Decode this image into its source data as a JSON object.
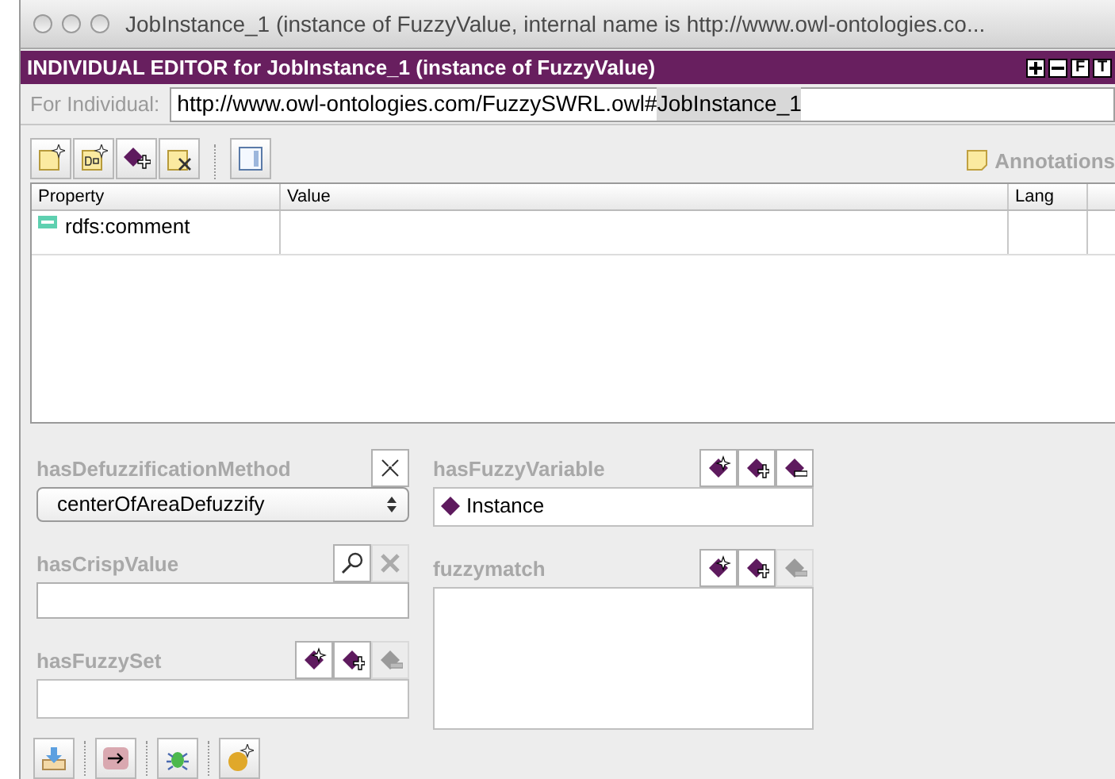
{
  "window": {
    "title": "JobInstance_1   (instance of FuzzyValue, internal name is http://www.owl-ontologies.co..."
  },
  "editor_header": {
    "title": "INDIVIDUAL EDITOR for JobInstance_1   (instance of FuzzyValue)",
    "buttons": [
      {
        "kind": "plus"
      },
      {
        "kind": "minus"
      },
      {
        "kind": "letter",
        "label": "F"
      },
      {
        "kind": "letter",
        "label": "T"
      }
    ]
  },
  "for_individual": {
    "label": "For Individual:",
    "value": "http://www.owl-ontologies.com/FuzzySWRL.owl#",
    "selected_text": "JobInstance_1"
  },
  "toolbar": {
    "buttons": [
      {
        "kind": "new-note"
      },
      {
        "kind": "new-datatype"
      },
      {
        "kind": "add-instance"
      },
      {
        "kind": "delete-note"
      },
      {
        "kind": "separator"
      },
      {
        "kind": "view"
      }
    ],
    "annotations_label": "Annotations"
  },
  "table": {
    "columns": [
      "Property",
      "Value",
      "Lang"
    ],
    "rows": [
      {
        "property": "rdfs:comment"
      }
    ]
  },
  "left_slots": [
    {
      "kind": "combo",
      "name": "hasDefuzzificationMethod",
      "buttons": [
        {
          "kind": "delete",
          "disabled": false
        }
      ],
      "value": "centerOfAreaDefuzzify"
    },
    {
      "kind": "text",
      "name": "hasCrispValue",
      "buttons": [
        {
          "kind": "search",
          "disabled": false
        },
        {
          "kind": "delete",
          "disabled": true
        }
      ]
    },
    {
      "kind": "list",
      "name": "hasFuzzySet",
      "buttons": [
        {
          "kind": "create",
          "disabled": false
        },
        {
          "kind": "add",
          "disabled": false
        },
        {
          "kind": "remove",
          "disabled": true
        }
      ]
    }
  ],
  "right_slots": [
    {
      "kind": "list",
      "name": "hasFuzzyVariable",
      "buttons": [
        {
          "kind": "create",
          "disabled": false
        },
        {
          "kind": "add",
          "disabled": false
        },
        {
          "kind": "remove",
          "disabled": false
        }
      ],
      "items": [
        "Instance"
      ]
    },
    {
      "kind": "list",
      "name": "fuzzymatch",
      "buttons": [
        {
          "kind": "create",
          "disabled": false
        },
        {
          "kind": "add",
          "disabled": false
        },
        {
          "kind": "remove",
          "disabled": true
        }
      ]
    }
  ],
  "bottom_toolbar": [
    {
      "kind": "download"
    },
    {
      "kind": "arrow"
    },
    {
      "kind": "bug"
    },
    {
      "kind": "new-ball"
    }
  ]
}
